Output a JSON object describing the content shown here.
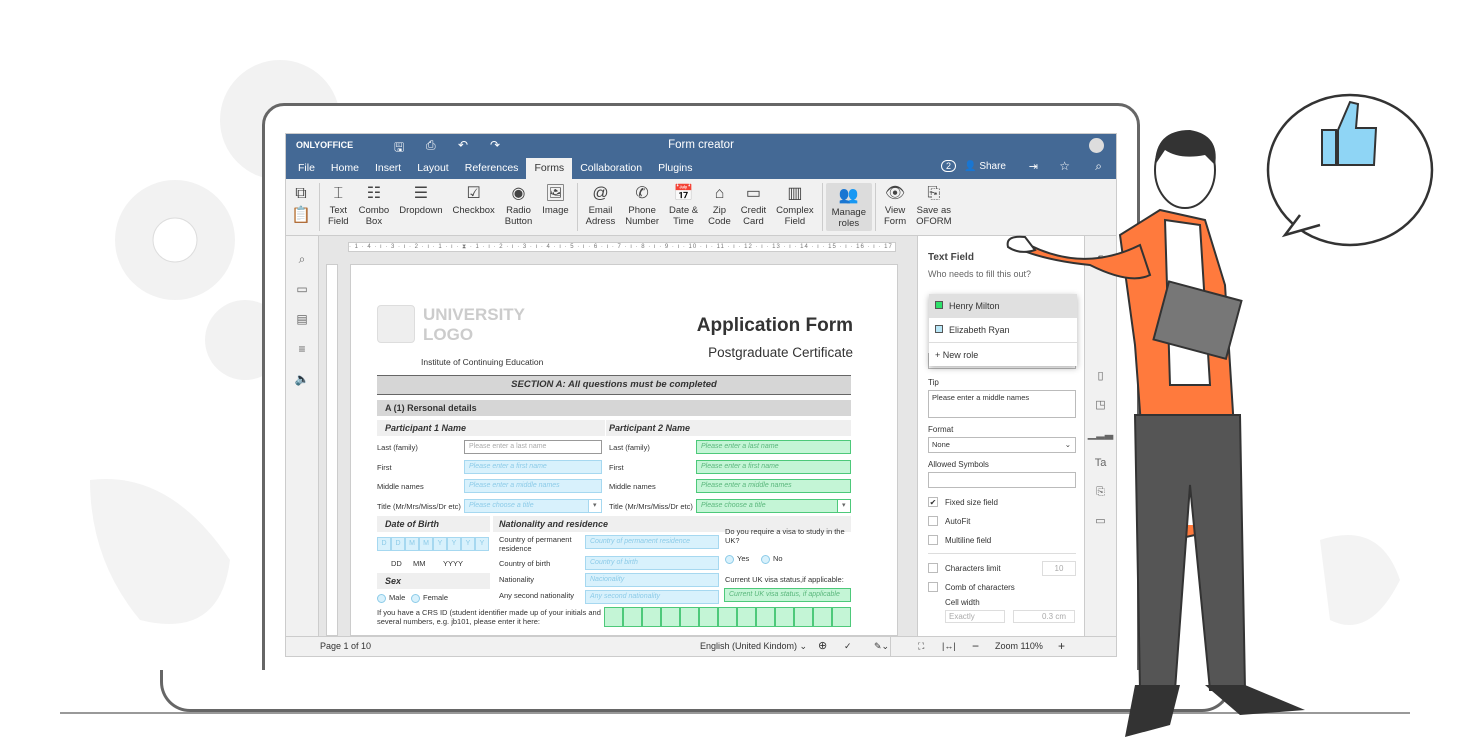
{
  "app": {
    "logo": "ONLYOFFICE",
    "title": "Form creator"
  },
  "menu": [
    "File",
    "Home",
    "Insert",
    "Layout",
    "References",
    "Forms",
    "Collaboration",
    "Plugins"
  ],
  "menu_active": "Forms",
  "header_right": {
    "users_count": "2",
    "share": "Share"
  },
  "toolbar": [
    {
      "icon": "text-field",
      "label": "Text\nField"
    },
    {
      "icon": "combo-box",
      "label": "Combo\nBox"
    },
    {
      "icon": "dropdown",
      "label": "Dropdown"
    },
    {
      "icon": "checkbox",
      "label": "Checkbox"
    },
    {
      "icon": "radio-button",
      "label": "Radio\nButton"
    },
    {
      "icon": "image",
      "label": "Image"
    },
    {
      "icon": "email",
      "label": "Email\nAdress"
    },
    {
      "icon": "phone",
      "label": "Phone\nNumber"
    },
    {
      "icon": "date-time",
      "label": "Date &\nTime"
    },
    {
      "icon": "zip",
      "label": "Zip\nCode"
    },
    {
      "icon": "credit-card",
      "label": "Credit\nCard"
    },
    {
      "icon": "complex-field",
      "label": "Complex\nField"
    },
    {
      "icon": "manage-roles",
      "label": "Manage\nroles"
    },
    {
      "icon": "view-form",
      "label": "View\nForm"
    },
    {
      "icon": "save-oform",
      "label": "Save as\nOFORM"
    }
  ],
  "document": {
    "logo_line1": "UNIVERSITY",
    "logo_line2": "LOGO",
    "institute": "Institute of Continuing Education",
    "title": "Application Form",
    "subtitle": "Postgraduate Certificate",
    "section": "SECTION A: All questions must be completed",
    "subsection": "A (1) Rersonal details",
    "p1": "Participant 1 Name",
    "p2": "Participant 2 Name",
    "labels": [
      "Last (family)",
      "First",
      "Middle names",
      "Title (Mr/Mrs/Miss/Dr etc)"
    ],
    "placeholders": [
      "Please enter a last name",
      "Please enter a first name",
      "Please enter a middle names",
      "Please choose a title"
    ],
    "dob": "Date of Birth",
    "dob_cells": [
      "D",
      "D",
      "M",
      "M",
      "Y",
      "Y",
      "Y",
      "Y"
    ],
    "dob_fmt": [
      "DD",
      "MM",
      "YYYY"
    ],
    "sex": "Sex",
    "male": "Male",
    "female": "Female",
    "nat": "Nationality and residence",
    "nat_labels": [
      "Country of permanent residence",
      "Country of birth",
      "Nationality",
      "Any second nationality"
    ],
    "nat_placeholders": [
      "Country of permanent residence",
      "Country of birth",
      "Nacionality",
      "Any second nationality"
    ],
    "visa_q": "Do you require a visa to study in the UK?",
    "yes": "Yes",
    "no": "No",
    "visa_status": "Current UK visa status,if applicable:",
    "visa_ph": "Current UK visa status, if applicable",
    "crs": "If you have a CRS ID (student identifier made up of your initials and several numbers, e.g. jb101, please enter it here:"
  },
  "panel": {
    "title": "Text Field",
    "who": "Who needs to fill this out?",
    "roles": [
      {
        "name": "Henry Milton",
        "color": "#2ee06a"
      },
      {
        "name": "Elizabeth Ryan",
        "color": "#b9e7f7"
      }
    ],
    "new_role": "New role",
    "tip_label": "Tip",
    "tip_value": "Please enter a middle names",
    "format_label": "Format",
    "format_value": "None",
    "allowed_label": "Allowed Symbols",
    "fixed": "Fixed size field",
    "fixed_checked": true,
    "autofit": "AutoFit",
    "multiline": "Multiline field",
    "chars_limit": "Characters limit",
    "chars_value": "10",
    "comb": "Comb of characters",
    "cell_width": "Cell width",
    "cell_mode": "Exactly",
    "cell_value": "0.3 cm"
  },
  "status": {
    "page": "Page 1 of 10",
    "language": "English (United Kindom)",
    "zoom": "Zoom 110%"
  },
  "colors": {
    "header": "#446995",
    "accent_green": "#c4f5d6",
    "accent_blue": "#d8f1fc",
    "jacket": "#ff7a3d"
  }
}
